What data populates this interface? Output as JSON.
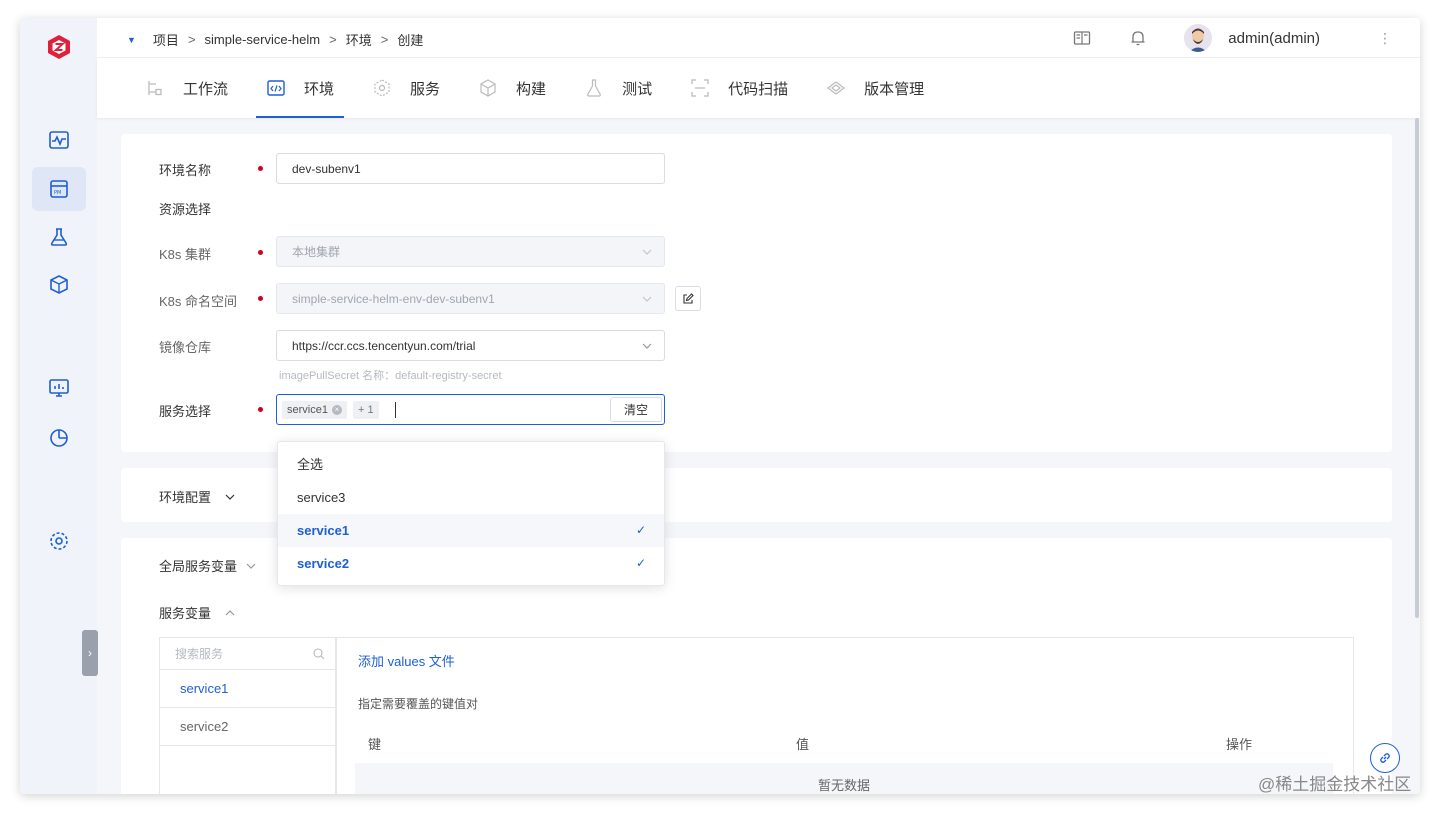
{
  "breadcrumb": [
    "项目",
    "simple-service-helm",
    "环境",
    "创建"
  ],
  "breadcrumb_separator": ">",
  "user": {
    "name": "admin(admin)"
  },
  "tabs": [
    {
      "label": "工作流",
      "icon": "workflow-icon"
    },
    {
      "label": "环境",
      "icon": "code-env-icon",
      "active": true
    },
    {
      "label": "服务",
      "icon": "service-icon"
    },
    {
      "label": "构建",
      "icon": "build-cube-icon"
    },
    {
      "label": "测试",
      "icon": "flask-icon"
    },
    {
      "label": "代码扫描",
      "icon": "scan-icon"
    },
    {
      "label": "版本管理",
      "icon": "version-icon"
    }
  ],
  "form": {
    "env_name_label": "环境名称",
    "env_name_value": "dev-subenv1",
    "resource_label": "资源选择",
    "cluster_label": "K8s 集群",
    "cluster_value": "本地集群",
    "namespace_label": "K8s 命名空间",
    "namespace_value": "simple-service-helm-env-dev-subenv1",
    "registry_label": "镜像仓库",
    "registry_value": "https://ccr.ccs.tencentyun.com/trial",
    "registry_hint": "imagePullSecret 名称：default-registry-secret",
    "services_label": "服务选择",
    "services_tag": "service1",
    "services_more": "+ 1",
    "clear_label": "清空"
  },
  "dropdown": {
    "options": [
      {
        "label": "全选",
        "selected": false
      },
      {
        "label": "service3",
        "selected": false
      },
      {
        "label": "service1",
        "selected": true
      },
      {
        "label": "service2",
        "selected": true
      }
    ],
    "check_mark": "✓"
  },
  "env_config": {
    "title": "环境配置"
  },
  "global_vars": {
    "title": "全局服务变量"
  },
  "service_vars": {
    "title": "服务变量",
    "search_placeholder": "搜索服务",
    "services": [
      "service1",
      "service2"
    ],
    "add_values": "添加 values 文件",
    "kv_title": "指定需要覆盖的键值对",
    "col_key": "键",
    "col_value": "值",
    "col_action": "操作",
    "empty": "暂无数据"
  },
  "watermark": "@稀土掘金技术社区",
  "colors": {
    "primary": "#1d5fd6",
    "required": "#d0021b",
    "logo": "#e0203a"
  }
}
